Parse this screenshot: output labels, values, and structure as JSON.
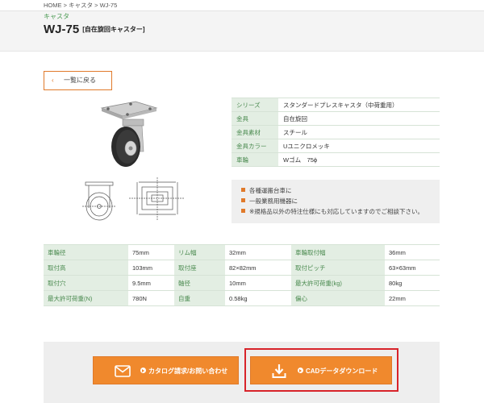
{
  "breadcrumb": "HOME > キャスタ > WJ-75",
  "header": {
    "category": "キャスタ",
    "title": "WJ-75",
    "subtitle": "[自在旋回キャスター]"
  },
  "back_button": {
    "icon": "chevron-left-icon",
    "label": "一覧に戻る"
  },
  "spec_table": [
    {
      "key": "シリーズ",
      "value": "スタンダードプレスキャスタ（中荷重用）"
    },
    {
      "key": "金具",
      "value": "自在旋回"
    },
    {
      "key": "金具素材",
      "value": "スチール"
    },
    {
      "key": "金具カラー",
      "value": "Uユニクロメッキ"
    },
    {
      "key": "車輪",
      "value": "Wゴム　75ϕ"
    }
  ],
  "notes": [
    "各種運搬台車に",
    "一般業務用機器に",
    "※規格品以外の特注仕様にも対応していますのでご相談下さい。"
  ],
  "specs": [
    [
      "車輪径",
      "75mm",
      "リム幅",
      "32mm",
      "車輪取付幅",
      "36mm"
    ],
    [
      "取付高",
      "103mm",
      "取付座",
      "82×82mm",
      "取付ピッチ",
      "63×63mm"
    ],
    [
      "取付穴",
      "9.5mm",
      "軸径",
      "10mm",
      "最大許可荷重(kg)",
      "80kg"
    ],
    [
      "最大許可荷重(N)",
      "780N",
      "自重",
      "0.58kg",
      "偏心",
      "22mm"
    ]
  ],
  "buttons": {
    "catalog": {
      "icon": "mail-icon",
      "label": "カタログ請求/お問い合わせ"
    },
    "cad": {
      "icon": "download-icon",
      "label": "CADデータダウンロード"
    }
  },
  "colors": {
    "accent_orange": "#f0892d",
    "table_key_bg": "#e3eee3",
    "table_key_text": "#4a8a4f",
    "highlight_red": "#d8232a"
  }
}
